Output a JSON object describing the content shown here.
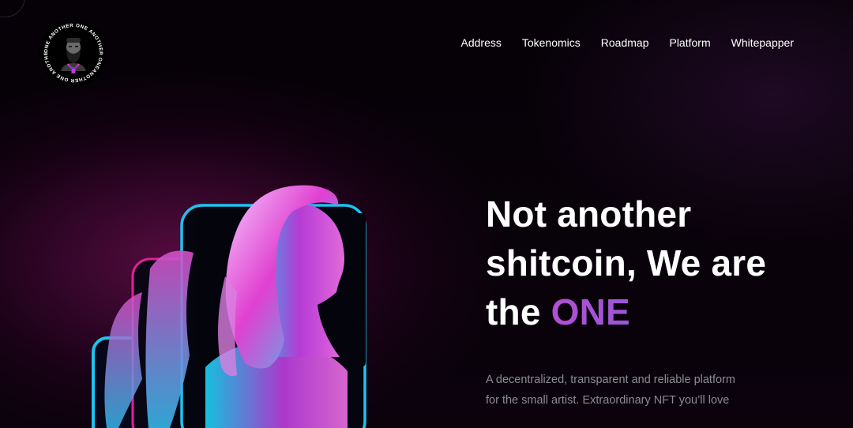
{
  "logo": {
    "ring_text": "ONE ANOTHER ONE ANOTHER ONEANOTHER ONE ANOTHER"
  },
  "nav": {
    "items": [
      "Address",
      "Tokenomics",
      "Roadmap",
      "Platform",
      "Whitepapper"
    ]
  },
  "hero": {
    "title_line1": "Not another",
    "title_line2": "shitcoin, We are",
    "title_line3_prefix": "the",
    "title_accent": "ONE",
    "description_line1": "A decentralized, transparent and reliable platform",
    "description_line2": "for the small artist. Extraordinary NFT you’ll love"
  },
  "colors": {
    "accent": "#a752d6",
    "neon_pink": "#e0219a",
    "neon_cyan": "#19c6f0",
    "text_muted": "#8c8c94"
  },
  "icons": {
    "logo": "bearded-man-avatar-icon"
  }
}
